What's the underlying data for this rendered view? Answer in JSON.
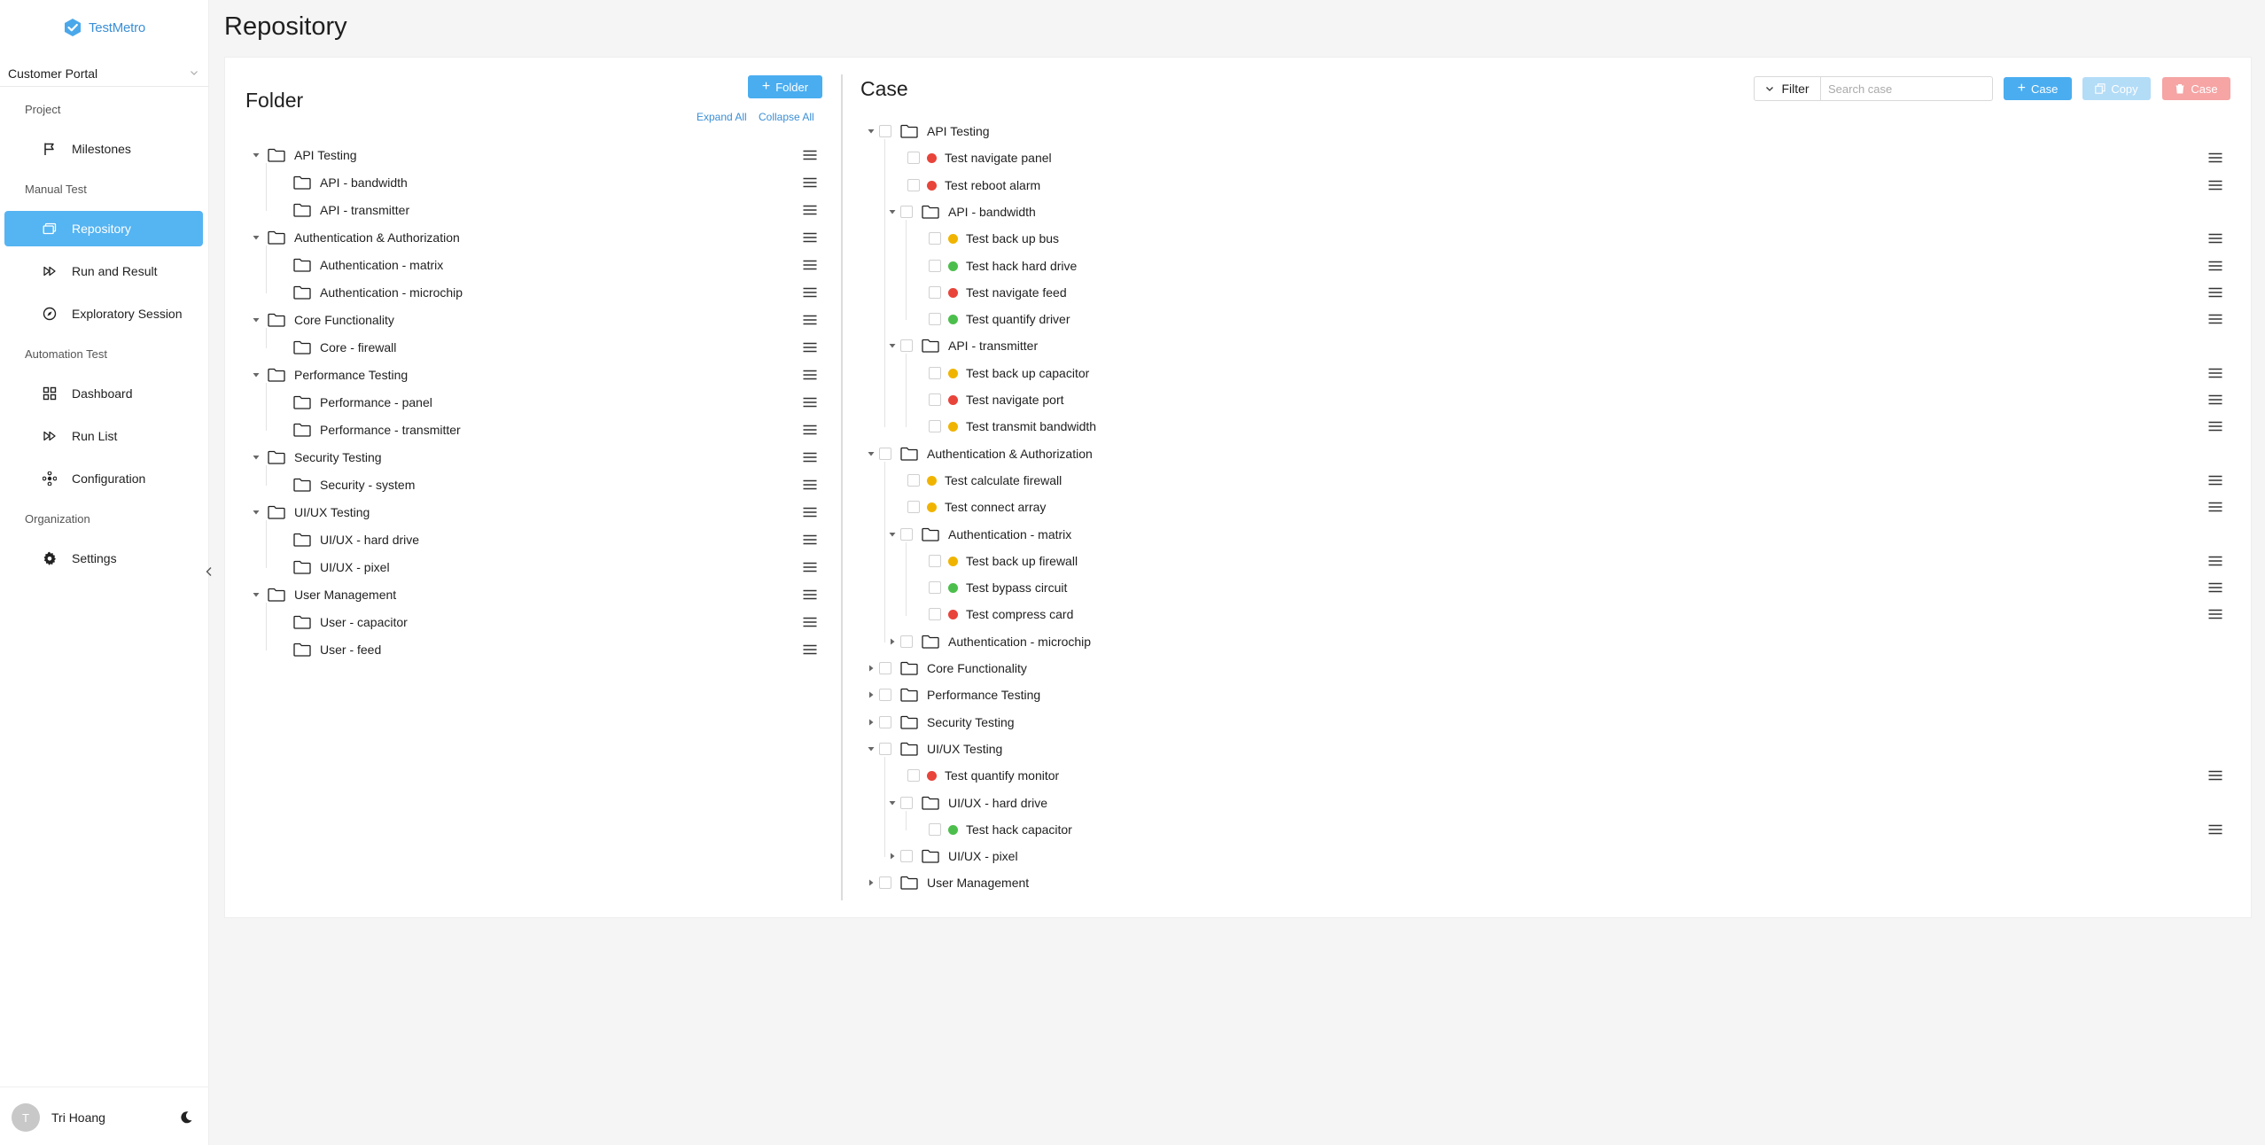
{
  "app": {
    "logo_text": "TestMetro",
    "page_title": "Repository"
  },
  "sidebar": {
    "project": "Customer Portal",
    "groups": {
      "project": "Project",
      "manual": "Manual Test",
      "automation": "Automation Test",
      "organization": "Organization"
    },
    "items": [
      {
        "label": "Milestones",
        "icon": "flag-icon"
      },
      {
        "label": "Repository",
        "icon": "repository-icon",
        "active": true
      },
      {
        "label": "Run and Result",
        "icon": "fast-forward-icon"
      },
      {
        "label": "Exploratory Session",
        "icon": "compass-icon"
      },
      {
        "label": "Dashboard",
        "icon": "dashboard-icon"
      },
      {
        "label": "Run List",
        "icon": "fast-forward-icon"
      },
      {
        "label": "Configuration",
        "icon": "network-icon"
      },
      {
        "label": "Settings",
        "icon": "gear-icon"
      }
    ],
    "user": {
      "initial": "T",
      "name": "Tri Hoang"
    }
  },
  "folder_panel": {
    "title": "Folder",
    "add_button": "Folder",
    "expand_all": "Expand All",
    "collapse_all": "Collapse All",
    "tree": [
      {
        "label": "API Testing",
        "level": 0
      },
      {
        "label": "API - bandwidth",
        "level": 1
      },
      {
        "label": "API - transmitter",
        "level": 1
      },
      {
        "label": "Authentication & Authorization",
        "level": 0
      },
      {
        "label": "Authentication - matrix",
        "level": 1
      },
      {
        "label": "Authentication - microchip",
        "level": 1
      },
      {
        "label": "Core Functionality",
        "level": 0
      },
      {
        "label": "Core - firewall",
        "level": 1
      },
      {
        "label": "Performance Testing",
        "level": 0
      },
      {
        "label": "Performance - panel",
        "level": 1
      },
      {
        "label": "Performance - transmitter",
        "level": 1
      },
      {
        "label": "Security Testing",
        "level": 0
      },
      {
        "label": "Security - system",
        "level": 1
      },
      {
        "label": "UI/UX Testing",
        "level": 0
      },
      {
        "label": "UI/UX - hard drive",
        "level": 1
      },
      {
        "label": "UI/UX - pixel",
        "level": 1
      },
      {
        "label": "User Management",
        "level": 0
      },
      {
        "label": "User - capacitor",
        "level": 1
      },
      {
        "label": "User - feed",
        "level": 1
      }
    ]
  },
  "case_panel": {
    "title": "Case",
    "filter_label": "Filter",
    "search_placeholder": "Search case",
    "add_case": "Case",
    "copy": "Copy",
    "delete_case": "Case",
    "colors": {
      "red": "#e8443a",
      "yellow": "#f0b400",
      "green": "#4cbe4c"
    },
    "tree": [
      {
        "type": "folder",
        "label": "API Testing",
        "level": 0,
        "state": "expanded"
      },
      {
        "type": "case",
        "label": "Test navigate panel",
        "level": 1,
        "status": "red"
      },
      {
        "type": "case",
        "label": "Test reboot alarm",
        "level": 1,
        "status": "red"
      },
      {
        "type": "folder",
        "label": "API - bandwidth",
        "level": 1,
        "state": "expanded"
      },
      {
        "type": "case",
        "label": "Test back up bus",
        "level": 2,
        "status": "yellow"
      },
      {
        "type": "case",
        "label": "Test hack hard drive",
        "level": 2,
        "status": "green"
      },
      {
        "type": "case",
        "label": "Test navigate feed",
        "level": 2,
        "status": "red"
      },
      {
        "type": "case",
        "label": "Test quantify driver",
        "level": 2,
        "status": "green"
      },
      {
        "type": "folder",
        "label": "API - transmitter",
        "level": 1,
        "state": "expanded"
      },
      {
        "type": "case",
        "label": "Test back up capacitor",
        "level": 2,
        "status": "yellow"
      },
      {
        "type": "case",
        "label": "Test navigate port",
        "level": 2,
        "status": "red"
      },
      {
        "type": "case",
        "label": "Test transmit bandwidth",
        "level": 2,
        "status": "yellow"
      },
      {
        "type": "folder",
        "label": "Authentication & Authorization",
        "level": 0,
        "state": "expanded"
      },
      {
        "type": "case",
        "label": "Test calculate firewall",
        "level": 1,
        "status": "yellow"
      },
      {
        "type": "case",
        "label": "Test connect array",
        "level": 1,
        "status": "yellow"
      },
      {
        "type": "folder",
        "label": "Authentication - matrix",
        "level": 1,
        "state": "expanded"
      },
      {
        "type": "case",
        "label": "Test back up firewall",
        "level": 2,
        "status": "yellow"
      },
      {
        "type": "case",
        "label": "Test bypass circuit",
        "level": 2,
        "status": "green"
      },
      {
        "type": "case",
        "label": "Test compress card",
        "level": 2,
        "status": "red"
      },
      {
        "type": "folder",
        "label": "Authentication - microchip",
        "level": 1,
        "state": "collapsed"
      },
      {
        "type": "folder",
        "label": "Core Functionality",
        "level": 0,
        "state": "collapsed"
      },
      {
        "type": "folder",
        "label": "Performance Testing",
        "level": 0,
        "state": "collapsed"
      },
      {
        "type": "folder",
        "label": "Security Testing",
        "level": 0,
        "state": "collapsed"
      },
      {
        "type": "folder",
        "label": "UI/UX Testing",
        "level": 0,
        "state": "expanded"
      },
      {
        "type": "case",
        "label": "Test quantify monitor",
        "level": 1,
        "status": "red"
      },
      {
        "type": "folder",
        "label": "UI/UX - hard drive",
        "level": 1,
        "state": "expanded"
      },
      {
        "type": "case",
        "label": "Test hack capacitor",
        "level": 2,
        "status": "green"
      },
      {
        "type": "folder",
        "label": "UI/UX - pixel",
        "level": 1,
        "state": "collapsed"
      },
      {
        "type": "folder",
        "label": "User Management",
        "level": 0,
        "state": "collapsed"
      }
    ]
  }
}
